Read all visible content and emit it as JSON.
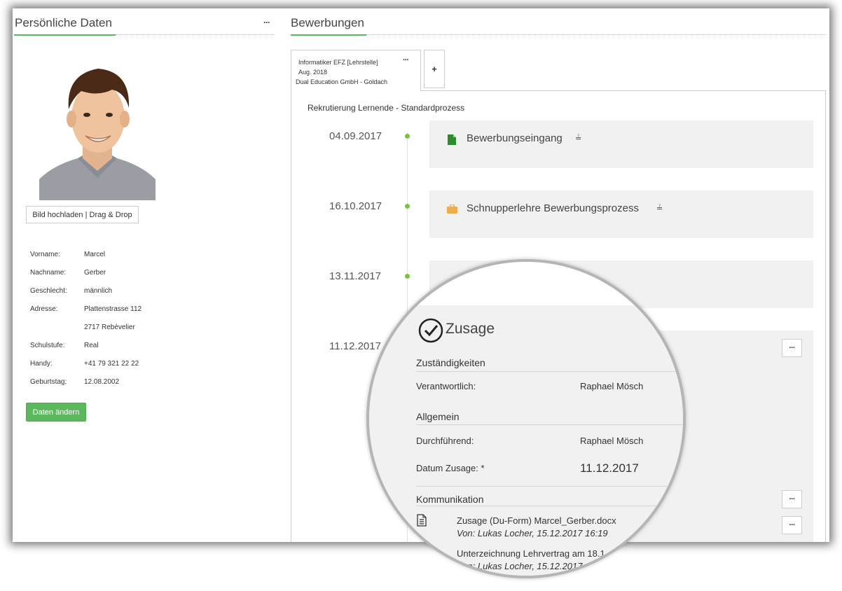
{
  "left": {
    "title": "Persönliche Daten",
    "more": "···",
    "upload_label": "Bild hochladen | Drag & Drop",
    "fields": [
      {
        "label": "Vorname:",
        "value": "Marcel"
      },
      {
        "label": "Nachname:",
        "value": "Gerber"
      },
      {
        "label": "Geschlecht:",
        "value": "männlich"
      },
      {
        "label": "Adresse:",
        "value": "Plattenstrasse 112"
      },
      {
        "label": "",
        "value": "2717 Rebévelier"
      },
      {
        "label": "Schulstufe:",
        "value": "Real"
      },
      {
        "label": "Handy:",
        "value": "+41 79 321 22 22"
      },
      {
        "label": "Geburtstag:",
        "value": "12.08.2002"
      }
    ],
    "edit_label": "Daten ändern"
  },
  "right": {
    "title": "Bewerbungen",
    "tab": {
      "line1": "Informatiker EFZ [Lehrstelle]",
      "line2": "Aug. 2018",
      "line3": "Dual Education GmbH - Goldach",
      "more": "···"
    },
    "add_tab": "+",
    "process_title": "Rekrutierung Lernende - Standardprozess",
    "steps": [
      {
        "date": "04.09.2017",
        "label": "Bewerbungseingang",
        "icon": "document-icon",
        "color": "#2e8b2e"
      },
      {
        "date": "16.10.2017",
        "label": "Schnupperlehre Bewerbungsprozess",
        "icon": "briefcase-icon",
        "color": "#f0ad4e"
      },
      {
        "date": "13.11.2017",
        "label": "",
        "icon": "briefcase-icon",
        "color": "#f0ad4e"
      },
      {
        "date": "11.12.2017",
        "label": "",
        "icon": "",
        "color": ""
      }
    ],
    "more": "···"
  },
  "magnifier": {
    "title": "Zusage",
    "sections": {
      "zust": "Zuständigkeiten",
      "allg": "Allgemein",
      "komm": "Kommunikation"
    },
    "verantwortlich_label": "Verantwortlich:",
    "verantwortlich_value": "Raphael Mösch",
    "durchfuehrend_label": "Durchführend:",
    "durchfuehrend_value": "Raphael Mösch",
    "datum_label": "Datum Zusage: *",
    "datum_value": "11.12.2017",
    "doc1_name": "Zusage (Du-Form) Marcel_Gerber.docx",
    "doc1_meta": "Von: Lukas Locher, 15.12.2017 16:19",
    "doc2_name": "Unterzeichnung Lehrvertrag am 18.1",
    "doc2_meta": "Von: Lukas Locher, 15.12.2017"
  },
  "colors": {
    "accent": "#5cb85c",
    "timeline_dot": "#7cc33a"
  }
}
